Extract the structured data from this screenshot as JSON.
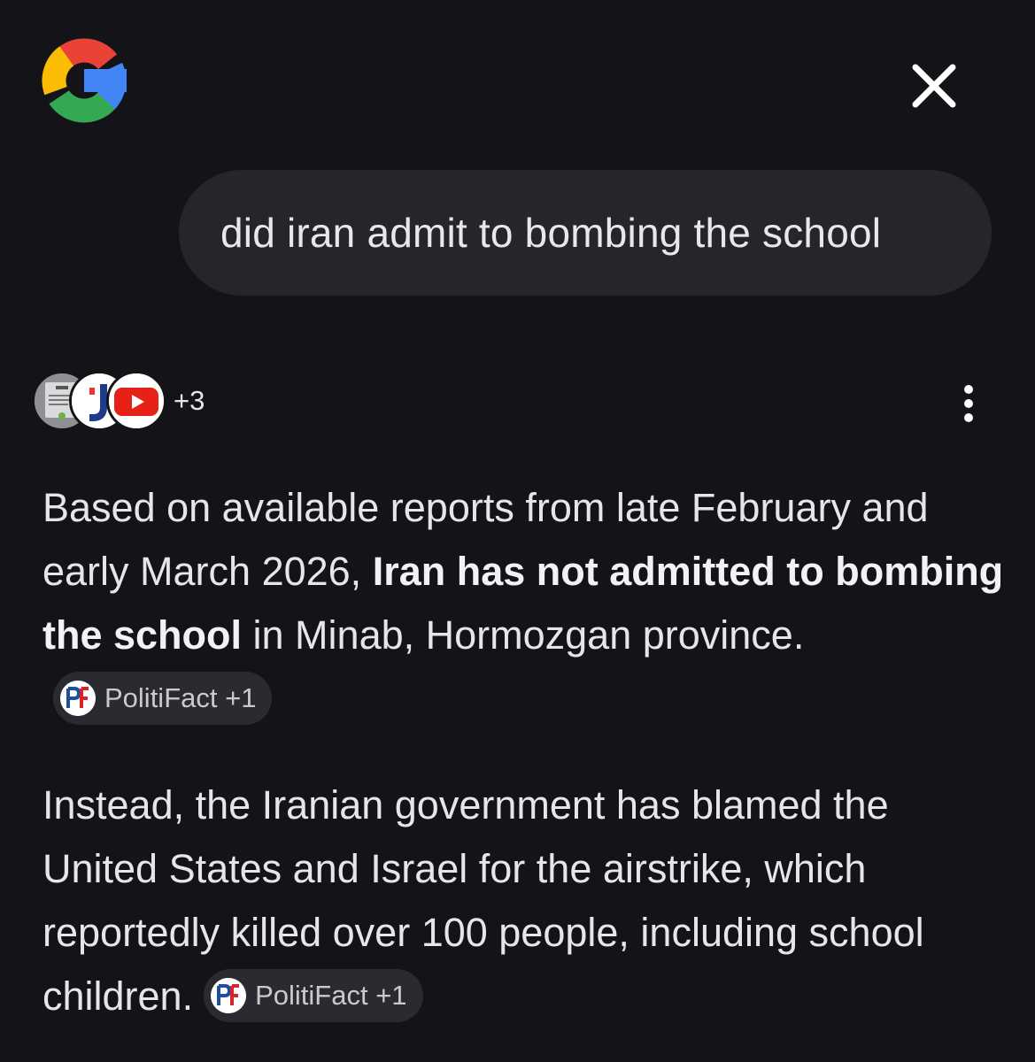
{
  "header": {
    "logo_icon": "google-g-icon",
    "close_icon": "close-icon"
  },
  "query": {
    "text": "did iran admit to bombing the school"
  },
  "sources": {
    "icons": [
      "news-thumbnail-icon",
      "j-logo-icon",
      "youtube-icon"
    ],
    "more_count": "+3",
    "menu_icon": "more-vert-icon"
  },
  "answer": {
    "p1_before": "Based on available reports from late February and early March 2026, ",
    "p1_bold": "Iran has not admitted to bombing the school",
    "p1_after": " in Minab, Hormozgan province.",
    "p1_chip": "PolitiFact +1",
    "p2_text": "Instead, the Iranian government has blamed the United States and Israel for the airstrike, which reportedly killed over 100 people, including school children.",
    "p2_chip": "PolitiFact +1"
  },
  "colors": {
    "background": "#141418",
    "bubble": "#25262c",
    "chip": "#2a2b31",
    "text": "#e6e6ea",
    "politifact_blue": "#1f4e9c",
    "politifact_red": "#d8232a"
  }
}
